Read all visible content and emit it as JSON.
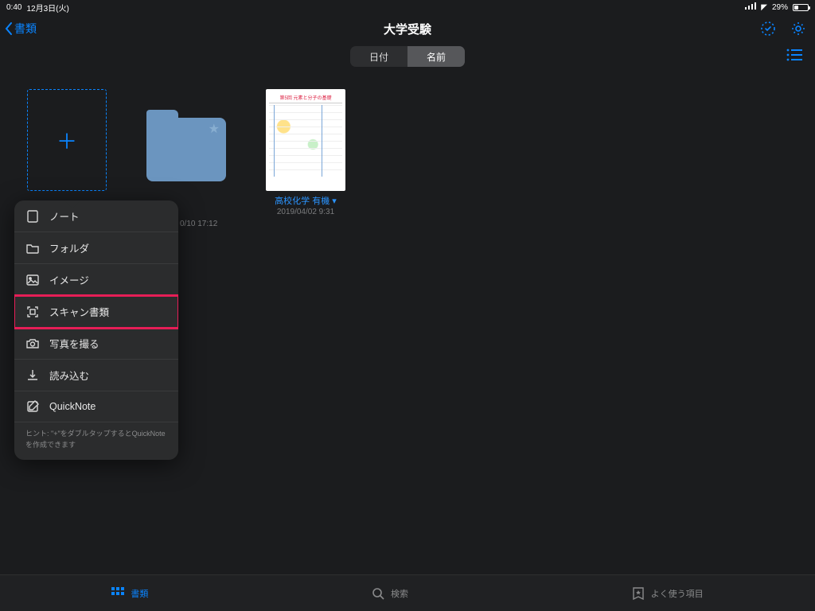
{
  "statusbar": {
    "time": "0:40",
    "date": "12月3日(火)",
    "battery": "29%"
  },
  "nav": {
    "back": "書類",
    "title": "大学受験"
  },
  "segmented": {
    "left": "日付",
    "right": "名前"
  },
  "folder": {
    "partial_time": "0/10 17:12"
  },
  "note": {
    "name": "高校化学 有機",
    "time": "2019/04/02 9:31",
    "preview_title": "第5回 元素と分子の基礎"
  },
  "popover": {
    "items": [
      "ノート",
      "フォルダ",
      "イメージ",
      "スキャン書類",
      "写真を撮る",
      "読み込む",
      "QuickNote"
    ],
    "hint": "ヒント: \"+\"をダブルタップするとQuickNoteを作成できます"
  },
  "tabs": {
    "documents": "書類",
    "search": "検索",
    "favorites": "よく使う項目"
  }
}
